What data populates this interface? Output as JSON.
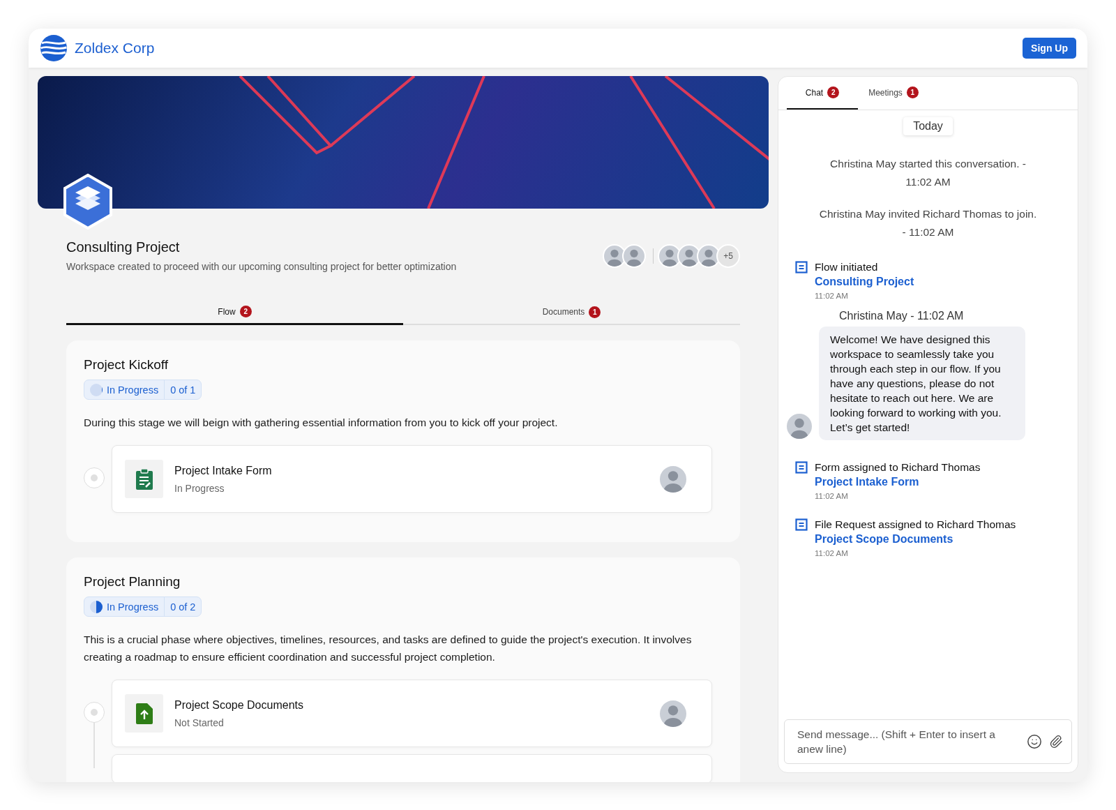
{
  "header": {
    "brand": "Zoldex Corp",
    "sign_up": "Sign Up"
  },
  "workspace": {
    "title": "Consulting Project",
    "description": "Workspace created to proceed with our upcoming consulting project for better optimization",
    "more_members": "+5"
  },
  "tabs": [
    {
      "label": "Flow",
      "badge": "2",
      "selected": true
    },
    {
      "label": "Documents",
      "badge": "1",
      "selected": false
    }
  ],
  "stages": [
    {
      "title": "Project Kickoff",
      "status": "In Progress",
      "progress": "0 of 1",
      "level": 0.05,
      "description": "During this stage we will beign with gathering essential information from you to kick off your project.",
      "tasks": [
        {
          "kind": "form",
          "name": "Project Intake Form",
          "status": "In Progress"
        }
      ]
    },
    {
      "title": "Project Planning",
      "status": "In Progress",
      "progress": "0 of 2",
      "level": 0.5,
      "description": "This is a crucial phase where objectives, timelines, resources, and tasks are defined to guide the project's execution. It involves creating a roadmap to ensure efficient coordination and successful project completion.",
      "tasks": [
        {
          "kind": "file_request",
          "name": "Project Scope Documents",
          "status": "Not Started"
        },
        {
          "kind": "blank"
        }
      ]
    }
  ],
  "chat": {
    "tabs": [
      {
        "label": "Chat",
        "badge": "2",
        "selected": true
      },
      {
        "label": "Meetings",
        "badge": "1",
        "selected": false
      }
    ],
    "date_divider": "Today",
    "events": [
      {
        "kind": "system",
        "text": "Christina May started this conversation. - 11:02 AM"
      },
      {
        "kind": "system",
        "text": "Christina May invited Richard Thomas  to join. - 11:02 AM"
      },
      {
        "kind": "activity",
        "text": "Flow initiated",
        "link": "Consulting Project",
        "time": "11:02 AM"
      },
      {
        "kind": "message",
        "sender": "Christina May - 11:02 AM",
        "text": "Welcome! We have designed this workspace to seamlessly take you through each step in our flow. If you have any questions, please do not hesitate to reach out here. We are looking forward to working with you. Let’s get started!"
      },
      {
        "kind": "activity",
        "text": "Form assigned to Richard Thomas",
        "link": "Project Intake Form",
        "time": "11:02 AM"
      },
      {
        "kind": "activity",
        "text": "File Request assigned to Richard Thomas",
        "link": "Project Scope Documents",
        "time": "11:02 AM"
      }
    ],
    "composer": {
      "placeholder": "Send message... (Shift + Enter to insert a anew line)"
    }
  }
}
